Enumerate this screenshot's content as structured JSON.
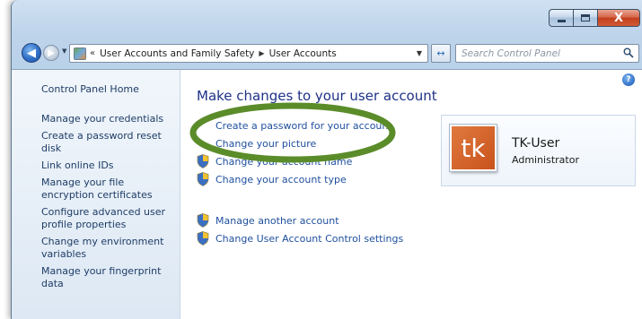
{
  "window": {
    "caption": {
      "minimize_glyph": "",
      "maximize_glyph": "",
      "close_glyph": "X"
    }
  },
  "nav": {
    "back_glyph": "◀",
    "forward_glyph": "▶",
    "recent_glyph": "▼",
    "breadcrumb": {
      "overflow": "«",
      "items": [
        "User Accounts and Family Safety",
        "User Accounts"
      ],
      "separator": "▶"
    },
    "address_dropdown": "▼",
    "refresh_glyph": "↔",
    "search_placeholder": "Search Control Panel"
  },
  "sidebar": {
    "home": "Control Panel Home",
    "links": [
      "Manage your credentials",
      "Create a password reset disk",
      "Link online IDs",
      "Manage your file encryption certificates",
      "Configure advanced user profile properties",
      "Change my environment variables",
      "Manage your fingerprint data"
    ]
  },
  "main": {
    "title": "Make changes to your user account",
    "tasks": [
      {
        "label": "Create a password for your account",
        "icon": "none"
      },
      {
        "label": "Change your picture",
        "icon": "none"
      },
      {
        "label": "Change your account name",
        "icon": "uac-shield-icon"
      },
      {
        "label": "Change your account type",
        "icon": "uac-shield-icon"
      }
    ],
    "other_tasks": [
      {
        "label": "Manage another account",
        "icon": "uac-shield-icon"
      },
      {
        "label": "Change User Account Control settings",
        "icon": "uac-shield-icon"
      }
    ],
    "help_glyph": "?"
  },
  "user": {
    "avatar_text": "tk",
    "name": "TK-User",
    "role": "Administrator"
  },
  "colors": {
    "link": "#1e4f9e",
    "title": "#1e3287",
    "highlight_ellipse": "#5b8c2a",
    "avatar": "#d2622b"
  }
}
